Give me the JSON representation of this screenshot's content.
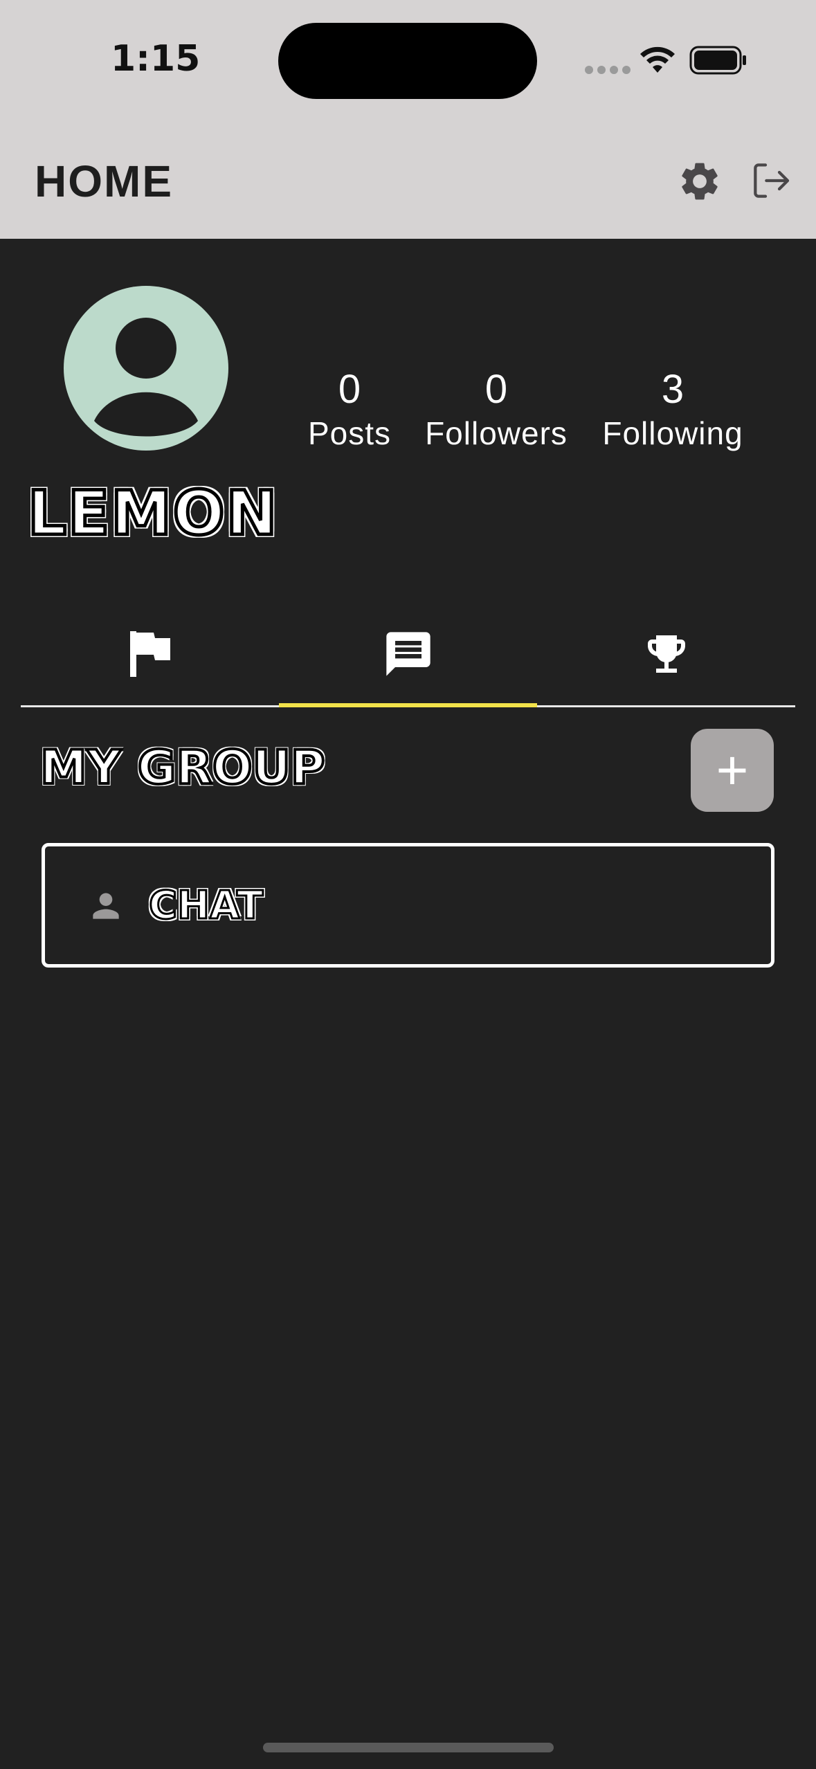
{
  "status_bar": {
    "time": "1:15"
  },
  "header": {
    "title": "HOME"
  },
  "profile": {
    "username": "LEMON",
    "stats": [
      {
        "value": "0",
        "label": "Posts"
      },
      {
        "value": "0",
        "label": "Followers"
      },
      {
        "value": "3",
        "label": "Following"
      }
    ]
  },
  "tabs": [
    {
      "icon": "flag-icon"
    },
    {
      "icon": "chat-icon",
      "active": true
    },
    {
      "icon": "trophy-icon"
    }
  ],
  "groups_section": {
    "title": "MY GROUP",
    "add_label": "+",
    "groups": [
      {
        "name": "CHAT",
        "icon": "person-icon"
      }
    ]
  },
  "colors": {
    "background": "#212121",
    "header_bg": "#d6d3d3",
    "avatar_bg": "#bcdacb",
    "tab_indicator": "#f2e24a",
    "add_button": "#a9a6a6"
  }
}
